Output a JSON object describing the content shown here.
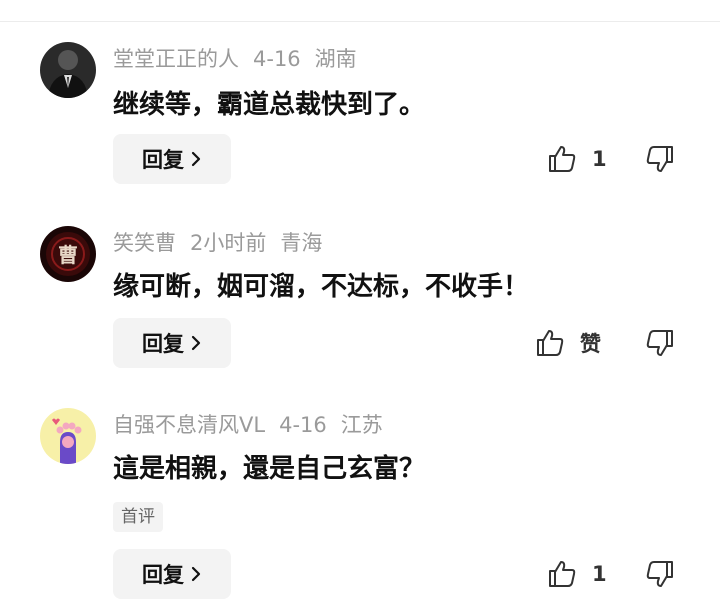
{
  "comments": [
    {
      "username": "堂堂正正的人",
      "time": "4-16",
      "location": "湖南",
      "text": "继续等，霸道总裁快到了。",
      "reply_label": "回复",
      "like_label": "1",
      "tag": null,
      "avatar_icon": "suit-man-avatar"
    },
    {
      "username": "笑笑曹",
      "time": "2小时前",
      "location": "青海",
      "text": "缘可断，姻可溜，不达标，不收手！",
      "reply_label": "回复",
      "like_label": "赞",
      "tag": null,
      "avatar_icon": "cao-avatar",
      "avatar_char": "曹"
    },
    {
      "username": "自强不息清风VL",
      "time": "4-16",
      "location": "江苏",
      "text": "這是相親，還是自己玄富？",
      "reply_label": "回复",
      "like_label": "1",
      "tag": "首评",
      "avatar_icon": "cat-paw-avatar"
    }
  ],
  "colors": {
    "meta": "#9a9a9a",
    "button_bg": "#f3f3f3",
    "text": "#111111"
  }
}
